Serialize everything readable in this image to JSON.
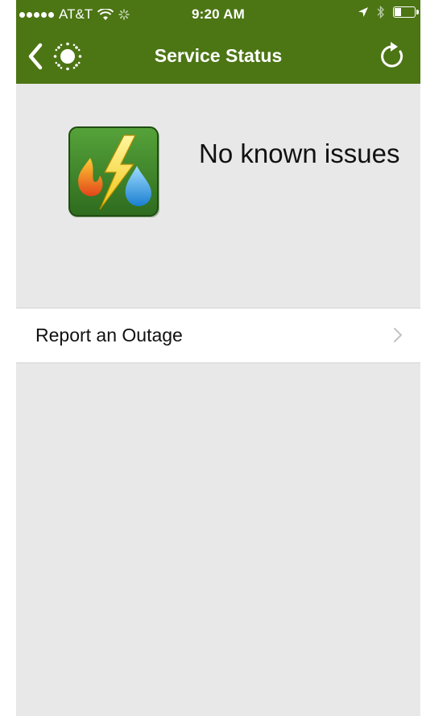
{
  "status_bar": {
    "carrier": "AT&T",
    "time": "9:20 AM"
  },
  "nav": {
    "title": "Service Status"
  },
  "service": {
    "status_text": "No known issues"
  },
  "actions": {
    "report_outage_label": "Report an Outage"
  },
  "icons": {
    "back": "chevron-left-icon",
    "brand": "sun-logo-icon",
    "refresh": "refresh-icon",
    "service": "gas-electric-water-icon",
    "row_chevron": "chevron-right-icon"
  },
  "colors": {
    "header": "#4c7514",
    "background": "#e8e8e8",
    "row": "#ffffff"
  }
}
